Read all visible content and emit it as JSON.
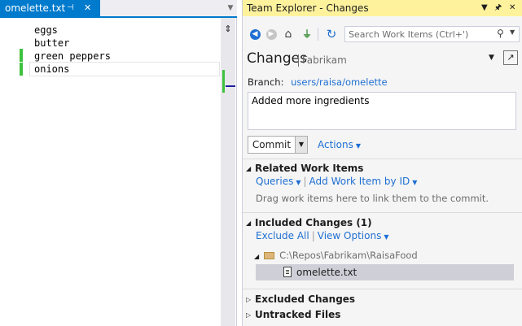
{
  "editor": {
    "tab_title": "omelette.txt",
    "tab_pin_glyph": "⊣",
    "tab_close_glyph": "✕",
    "lines": [
      "eggs",
      "butter",
      "green peppers",
      "onions"
    ],
    "added_line_indices": [
      2,
      3
    ],
    "change_color": "#3ec13e"
  },
  "team_explorer": {
    "title": "Team Explorer - Changes",
    "title_bar_color": "#fff29d",
    "toolbar": {
      "icons": [
        "back-icon",
        "forward-icon",
        "home-icon",
        "connect-icon",
        "refresh-icon"
      ],
      "search_placeholder": "Search Work Items (Ctrl+')"
    },
    "header": {
      "title": "Changes",
      "project": "Fabrikam"
    },
    "branch": {
      "label": "Branch:",
      "name": "users/raisa/omelette"
    },
    "commit_message": "Added more ingredients",
    "commit_button_label": "Commit",
    "actions_label": "Actions",
    "related_work_items": {
      "header": "Related Work Items",
      "queries_label": "Queries",
      "add_work_item_label": "Add Work Item by ID",
      "hint": "Drag work items here to link them to the commit."
    },
    "included_changes": {
      "header": "Included Changes (1)",
      "exclude_all_label": "Exclude All",
      "view_options_label": "View Options",
      "folder_path": "C:\\Repos\\Fabrikam\\RaisaFood",
      "file_name": "omelette.txt"
    },
    "excluded_changes": {
      "header": "Excluded Changes"
    },
    "untracked_files": {
      "header": "Untracked Files"
    },
    "accent_color": "#1e6fd3"
  }
}
